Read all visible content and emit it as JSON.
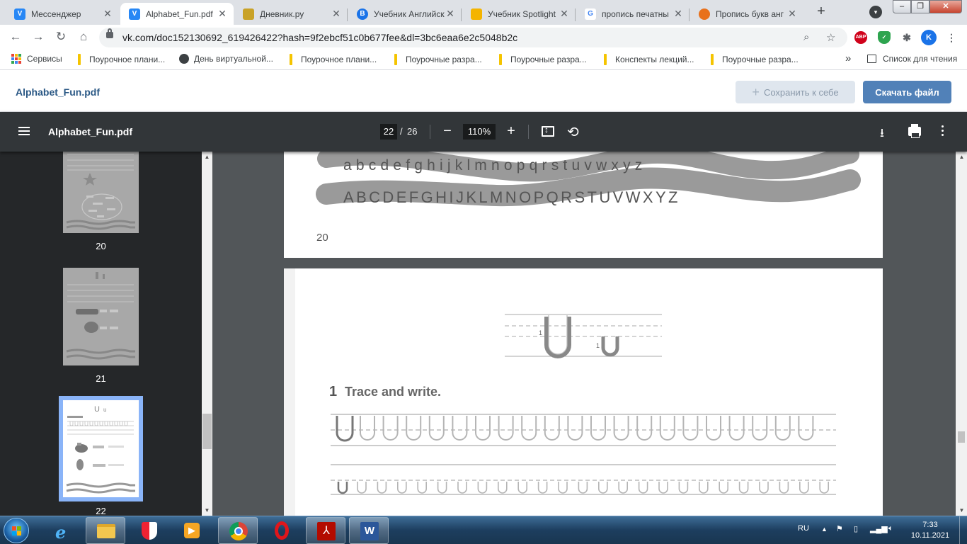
{
  "browser": {
    "tabs": [
      {
        "title": "Мессенджер",
        "icon": "vk-messenger-icon",
        "color": "#2787f5",
        "active": false
      },
      {
        "title": "Alphabet_Fun.pdf",
        "icon": "vk-icon",
        "color": "#2787f5",
        "active": true
      },
      {
        "title": "Дневник.ру",
        "icon": "dnevnik-icon",
        "color": "#c9a227",
        "active": false
      },
      {
        "title": "Учебник Английск",
        "icon": "b-icon",
        "color": "#1a73e8",
        "active": false
      },
      {
        "title": "Учебник Spotlight",
        "icon": "spotlight-icon",
        "color": "#f4b400",
        "active": false
      },
      {
        "title": "пропись печатны",
        "icon": "google-icon",
        "color": "#ffffff",
        "active": false
      },
      {
        "title": "Пропись букв анг",
        "icon": "fruit-icon",
        "color": "#e8711c",
        "active": false
      }
    ],
    "new_tab": "+",
    "address": "vk.com/doc152130692_619426422?hash=9f2ebcf51c0b677fee&dl=3bc6eaa6e2c5048b2c",
    "profile_letter": "K",
    "abp_label": "ABP",
    "bookmarks": [
      {
        "label": "Сервисы",
        "type": "apps"
      },
      {
        "label": "Поурочное плани...",
        "type": "folder"
      },
      {
        "label": "День виртуальной...",
        "type": "globe"
      },
      {
        "label": "Поурочное плани...",
        "type": "folder"
      },
      {
        "label": "Поурочные разра...",
        "type": "folder"
      },
      {
        "label": "Поурочные разра...",
        "type": "folder"
      },
      {
        "label": "Конспекты лекций...",
        "type": "folder"
      },
      {
        "label": "Поурочные разра...",
        "type": "folder"
      }
    ],
    "bookmarks_overflow": "»",
    "reading_list": "Список для чтения"
  },
  "vk": {
    "doc_title": "Alphabet_Fun.pdf",
    "save_button": "Сохранить к себе",
    "download_button": "Скачать файл"
  },
  "pdf": {
    "title": "Alphabet_Fun.pdf",
    "current_page": "22",
    "page_separator": "/",
    "total_pages": "26",
    "zoom": "110%",
    "thumbnails": [
      {
        "label": "20",
        "current": false
      },
      {
        "label": "21",
        "current": false
      },
      {
        "label": "22",
        "current": true
      }
    ],
    "page20": {
      "lower_alphabet": "abcdefghijklmnopqrstuvwxyz",
      "upper_alphabet": "ABCDEFGHIJKLMNOPQRSTUVWXYZ",
      "page_number": "20"
    },
    "page22": {
      "big_letter_upper": "U",
      "big_letter_lower": "u",
      "stroke_number": "1",
      "exercise_number": "1",
      "exercise_text": "Trace and write.",
      "trace_upper": "U",
      "trace_lower": "u"
    }
  },
  "taskbar": {
    "lang": "RU",
    "time": "7:33",
    "date": "10.11.2021",
    "apps": [
      "explorer",
      "internet-explorer",
      "security-shield",
      "media-player",
      "chrome",
      "opera",
      "acrobat",
      "word"
    ]
  }
}
